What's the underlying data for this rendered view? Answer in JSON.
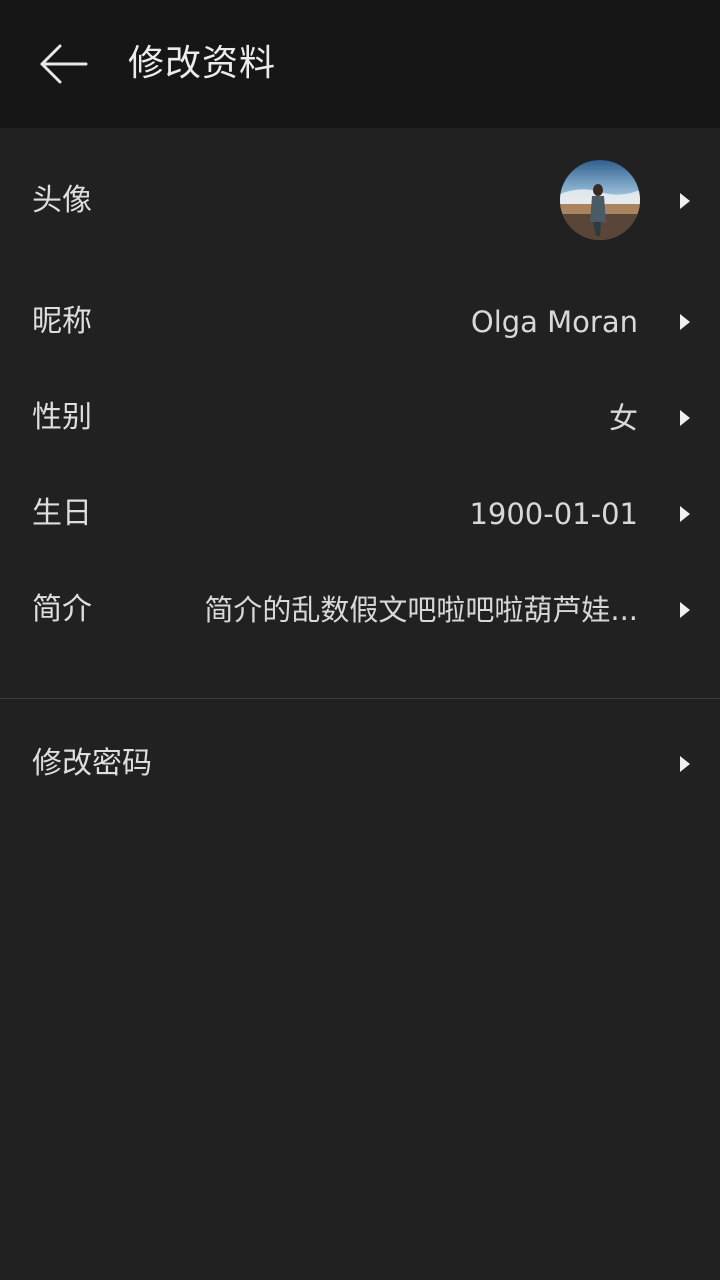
{
  "header": {
    "title": "修改资料",
    "back_icon": "arrow-left-icon"
  },
  "profile": {
    "avatar": {
      "label": "头像",
      "icon": "avatar-photo"
    },
    "nickname": {
      "label": "昵称",
      "value": "Olga Moran"
    },
    "gender": {
      "label": "性别",
      "value": "女"
    },
    "birthday": {
      "label": "生日",
      "value": "1900-01-01"
    },
    "bio": {
      "label": "简介",
      "value": "简介的乱数假文吧啦吧啦葫芦娃..."
    }
  },
  "security": {
    "change_password": {
      "label": "修改密码"
    }
  },
  "colors": {
    "background": "#212121",
    "topbar": "#161616",
    "text": "#e6e6e6",
    "divider": "#3a3a3a"
  }
}
